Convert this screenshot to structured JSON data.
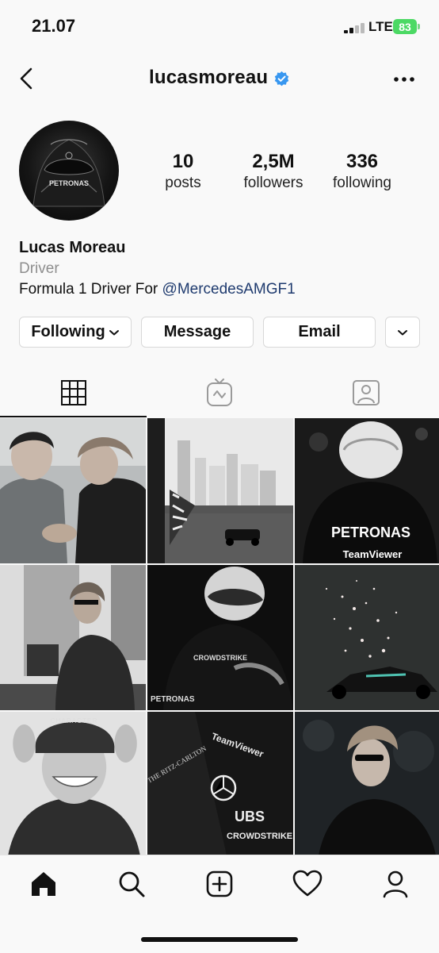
{
  "status_bar": {
    "time": "21.07",
    "network": "LTE",
    "battery": "83"
  },
  "header": {
    "username": "lucasmoreau",
    "verified": true
  },
  "profile": {
    "avatar_text": "PETRONAS",
    "stats": [
      {
        "value": "10",
        "label": "posts"
      },
      {
        "value": "2,5M",
        "label": "followers"
      },
      {
        "value": "336",
        "label": "following"
      }
    ],
    "display_name": "Lucas Moreau",
    "category": "Driver",
    "bio_text": "Formula 1 Driver For ",
    "bio_mention": "@MercedesAMGF1"
  },
  "actions": {
    "following_label": "Following",
    "message_label": "Message",
    "email_label": "Email"
  },
  "tabs": [
    "grid-icon",
    "igtv-icon",
    "tagged-icon"
  ],
  "posts": {
    "p3_text_1": "PETRONAS",
    "p3_text_2": "TeamViewer",
    "p5_text_1": "CROWDSTRIKE",
    "p5_text_2": "PETRONAS",
    "p7_text": "CHARACTER",
    "p8_text_1": "TeamViewer",
    "p8_text_2": "THE RITZ-CARLTON",
    "p8_text_3": "UBS",
    "p8_text_4": "CROWDSTRIKE"
  },
  "bottom_nav": [
    "home-icon",
    "search-icon",
    "create-icon",
    "activity-icon",
    "profile-icon"
  ],
  "colors": {
    "verified": "#3897f0",
    "link": "#1e3a6e",
    "battery": "#4cd964"
  }
}
